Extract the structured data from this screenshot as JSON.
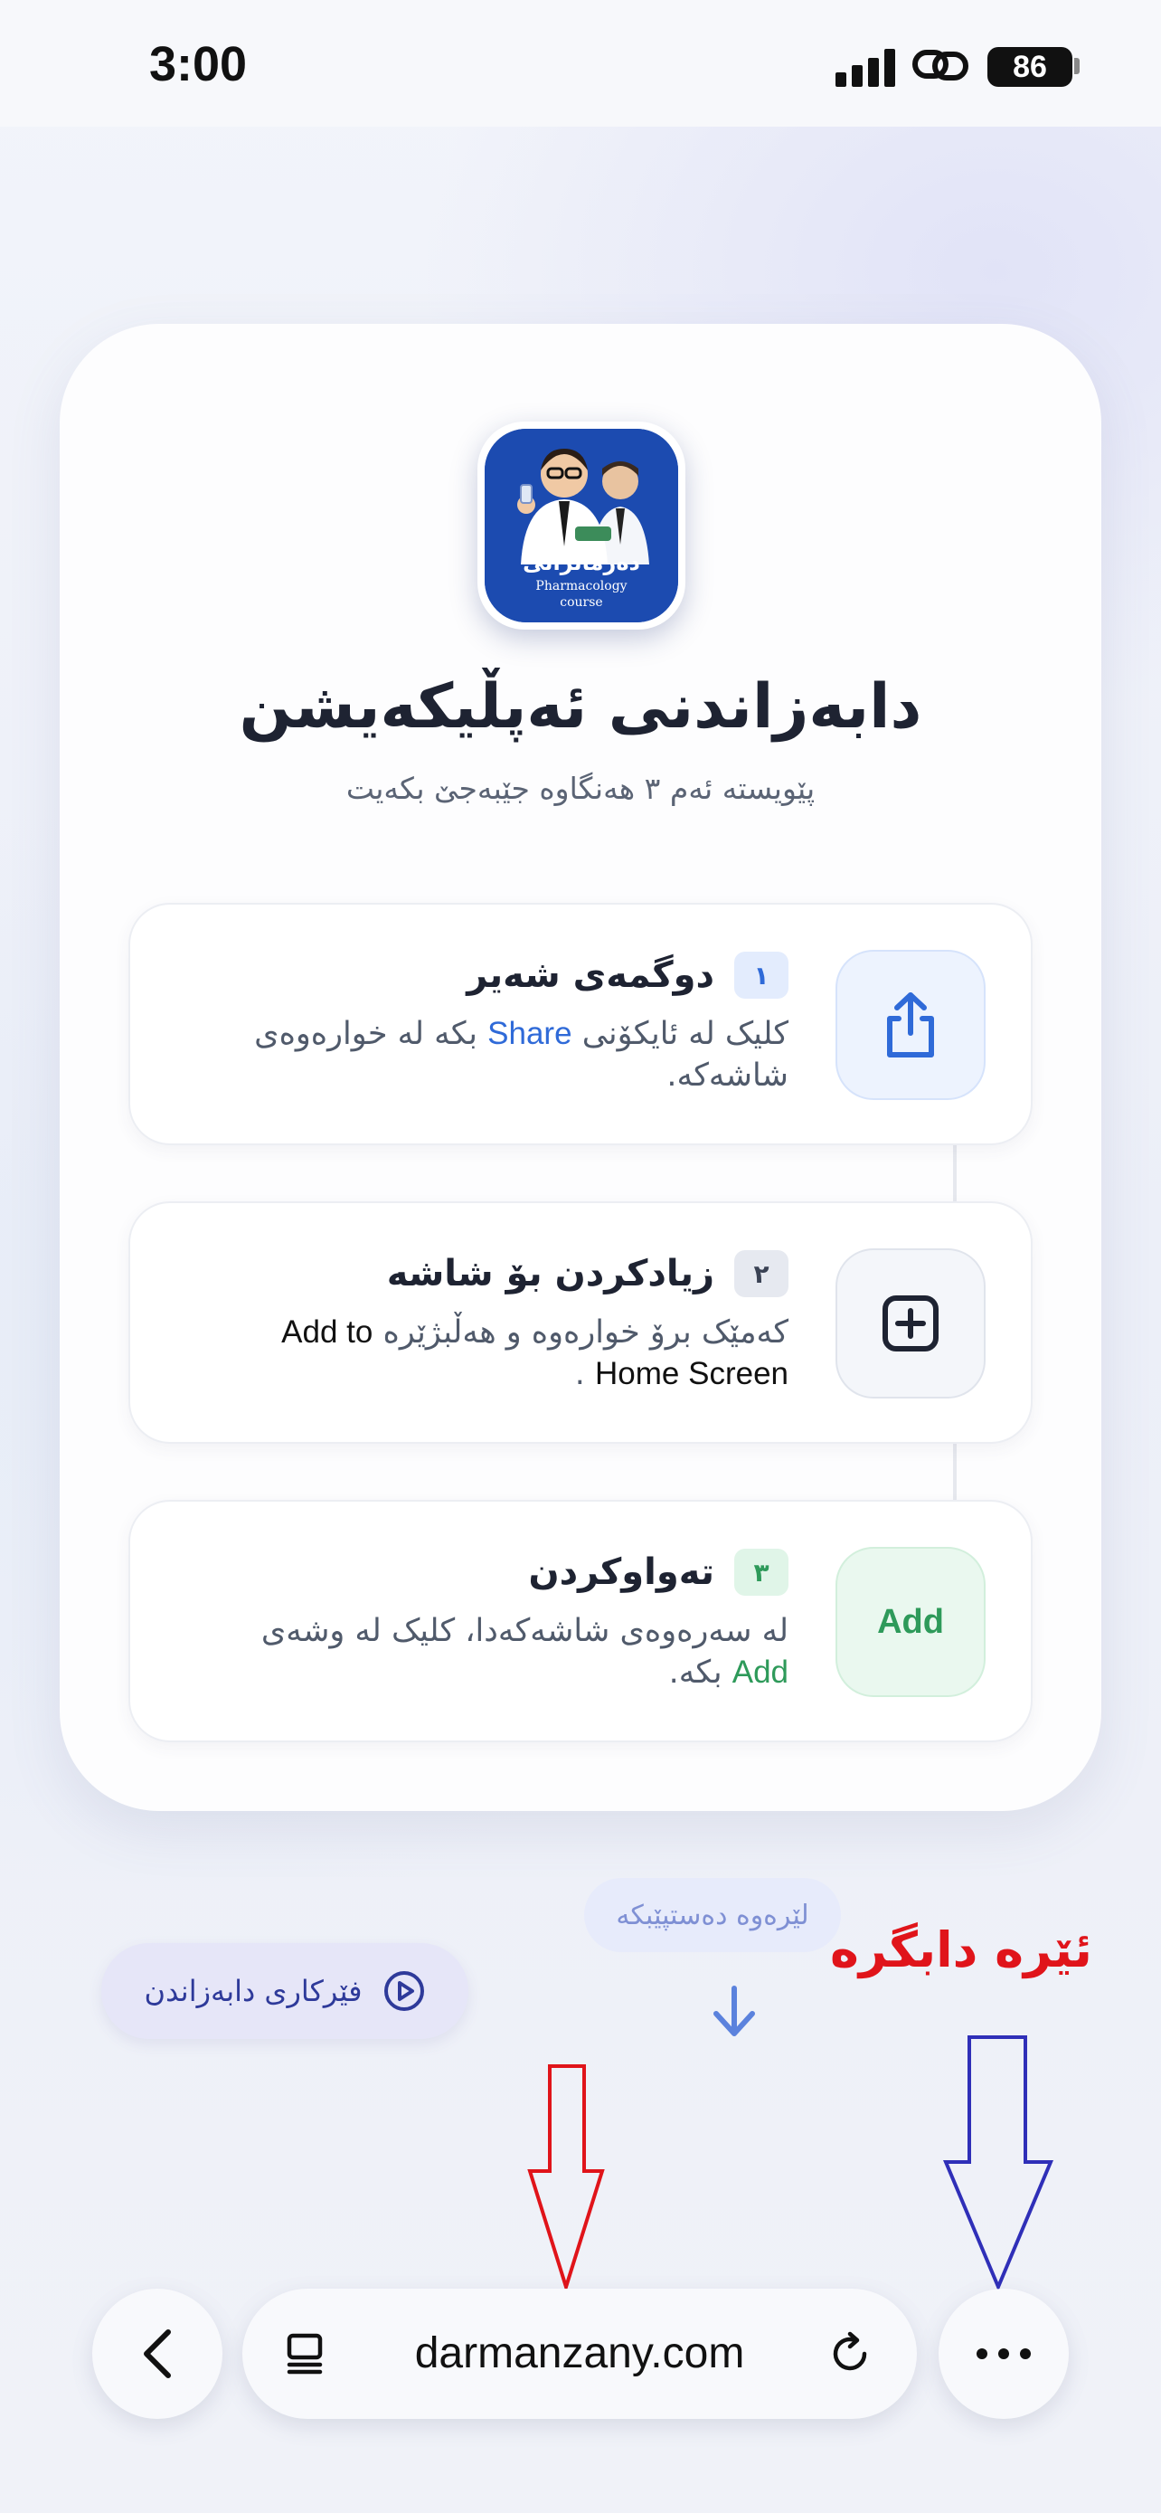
{
  "status_bar": {
    "time": "3:00",
    "battery": "86"
  },
  "app": {
    "logo_text_ku": "دەرمانزانی",
    "logo_text_en_1": "Pharmacology",
    "logo_text_en_2": "course",
    "title": "دابەزاندنی ئەپڵیکەیشن",
    "subtitle": "پێویستە ئەم ٣ هەنگاوە جێبەجێ بکەیت"
  },
  "steps": [
    {
      "number": "١",
      "title": "دوگمەی شەیر",
      "desc_1": "کلیک لە ئایکۆنی",
      "desc_highlight": "Share",
      "desc_2": "بکە لە خوارەوەی شاشەکە.",
      "icon": "share-icon",
      "accent": "#2f6ad8"
    },
    {
      "number": "٢",
      "title": "زیادکردن بۆ شاشە",
      "desc_1": "کەمێک برۆ خوارەوە و هەڵبژێرە",
      "desc_highlight": "Add to Home Screen",
      "desc_2": ".",
      "icon": "plus-square-icon",
      "accent": "#1e2332"
    },
    {
      "number": "٣",
      "title": "تەواوکردن",
      "desc_1": "لە سەرەوەی شاشەکەدا، کلیک لە وشەی",
      "desc_highlight": "Add",
      "desc_2": "بکە.",
      "button_label": "Add",
      "accent": "#2e9a5a"
    }
  ],
  "start_hint": "لێرەوە دەستپێبکە",
  "tutorial_button": "فێرکاری دابەزاندن",
  "annotation_text": "ئێرە دابگرە",
  "browser": {
    "url": "darmanzany.com"
  },
  "colors": {
    "annotation_red": "#e0141a",
    "annotation_blue": "#2f2fb8"
  }
}
